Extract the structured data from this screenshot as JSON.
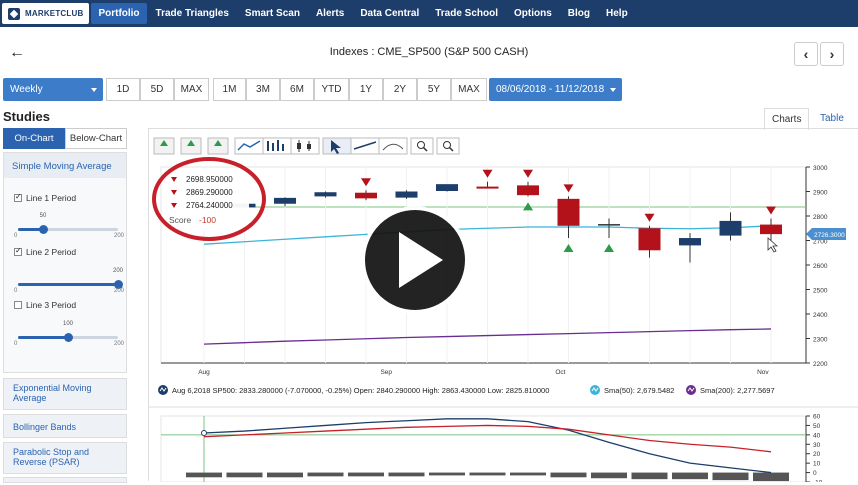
{
  "nav": {
    "logo": "MARKETCLUB",
    "items": [
      "Portfolio",
      "Trade Triangles",
      "Smart Scan",
      "Alerts",
      "Data Central",
      "Trade School",
      "Options",
      "Blog",
      "Help"
    ],
    "active": "Portfolio"
  },
  "header": {
    "title": "Indexes : CME_SP500 (S&P 500 CASH)",
    "back": "🡐",
    "prev": "‹",
    "next": "›"
  },
  "toolbar": {
    "period": "Weekly",
    "ranges1": [
      "1D",
      "5D",
      "MAX"
    ],
    "ranges2": [
      "1M",
      "3M",
      "6M",
      "YTD",
      "1Y",
      "2Y",
      "5Y",
      "MAX"
    ],
    "date_range": "08/06/2018 - 11/12/2018"
  },
  "studies": {
    "title": "Studies",
    "tab_on": "On-Chart",
    "tab_below": "Below-Chart",
    "sma_title": "Simple Moving Average",
    "lines": [
      {
        "label": "Line 1 Period",
        "checked": true,
        "value": "50",
        "min": "0",
        "max": "200",
        "fraction": 0.25
      },
      {
        "label": "Line 2 Period",
        "checked": true,
        "value": "200",
        "min": "0",
        "max": "200",
        "fraction": 1.0
      },
      {
        "label": "Line 3 Period",
        "checked": false,
        "value": "100",
        "min": "0",
        "max": "200",
        "fraction": 0.5
      }
    ],
    "others": [
      "Exponential Moving Average",
      "Bollinger Bands",
      "Parabolic Stop and Reverse (PSAR)"
    ]
  },
  "chart_tabs": [
    "Charts",
    "Table"
  ],
  "callout": {
    "values": [
      "2698.950000",
      "2869.290000",
      "2764.240000"
    ],
    "score_label": "Score",
    "score_value": "-100"
  },
  "legend": {
    "ohlc": "Aug 6,2018 SP500: 2833.280000 (-7.070000, -0.25%) Open: 2840.290000 High: 2863.430000 Low: 2825.810000",
    "sma50": "Sma(50): 2,679.5482",
    "sma200": "Sma(200): 2,277.5697"
  },
  "last_price_tag": "2726.3000",
  "colors": {
    "nav_bg": "#1d3d6b",
    "accent": "#2b63b0",
    "bull": "#1d3d6b",
    "bear": "#b3121a",
    "sma50": "#3bb4d9",
    "sma200": "#6a2c91",
    "triangle_up": "#2e9b4b"
  },
  "chart_data": {
    "type": "candlestick",
    "x_labels": [
      "Aug",
      "Sep",
      "Oct",
      "Nov"
    ],
    "y_ticks": [
      "3000",
      "2900",
      "2800",
      "2700",
      "2600",
      "2500",
      "2400",
      "2300",
      "2200"
    ],
    "ylim": [
      2200,
      3000
    ],
    "candles": [
      {
        "o": 2840,
        "h": 2863,
        "l": 2826,
        "c": 2833
      },
      {
        "o": 2835,
        "h": 2855,
        "l": 2830,
        "c": 2850
      },
      {
        "o": 2850,
        "h": 2876,
        "l": 2840,
        "c": 2874
      },
      {
        "o": 2880,
        "h": 2900,
        "l": 2875,
        "c": 2897
      },
      {
        "o": 2895,
        "h": 2905,
        "l": 2865,
        "c": 2872
      },
      {
        "o": 2875,
        "h": 2905,
        "l": 2870,
        "c": 2900
      },
      {
        "o": 2902,
        "h": 2920,
        "l": 2900,
        "c": 2930
      },
      {
        "o": 2920,
        "h": 2940,
        "l": 2915,
        "c": 2916
      },
      {
        "o": 2925,
        "h": 2940,
        "l": 2880,
        "c": 2885
      },
      {
        "o": 2870,
        "h": 2880,
        "l": 2710,
        "c": 2760
      },
      {
        "o": 2767,
        "h": 2790,
        "l": 2710,
        "c": 2767
      },
      {
        "o": 2750,
        "h": 2760,
        "l": 2630,
        "c": 2660
      },
      {
        "o": 2680,
        "h": 2730,
        "l": 2610,
        "c": 2710
      },
      {
        "o": 2720,
        "h": 2815,
        "l": 2700,
        "c": 2780
      },
      {
        "o": 2765,
        "h": 2790,
        "l": 2700,
        "c": 2726
      }
    ],
    "sma50": [
      2685,
      2695,
      2705,
      2715,
      2725,
      2735,
      2745,
      2750,
      2755,
      2755,
      2755,
      2750,
      2748,
      2752,
      2760
    ],
    "sma200": [
      2277,
      2283,
      2289,
      2294,
      2299,
      2304,
      2308,
      2312,
      2316,
      2320,
      2324,
      2328,
      2332,
      2336,
      2339
    ],
    "oscillator": {
      "y_ticks": [
        "60",
        "50",
        "40",
        "30",
        "20",
        "10",
        "0",
        "-10"
      ],
      "ylim": [
        -10,
        60
      ],
      "line_dark": [
        42,
        44,
        47,
        50,
        53,
        55,
        57,
        57,
        54,
        45,
        32,
        20,
        10,
        5,
        0
      ],
      "line_red": [
        38,
        40,
        42,
        44,
        46,
        48,
        49,
        50,
        49,
        46,
        40,
        34,
        30,
        27,
        22
      ],
      "bars": [
        -5,
        -5,
        -5,
        -4,
        -4,
        -4,
        -3,
        -3,
        -3,
        -5,
        -6,
        -7,
        -7,
        -8,
        -9
      ]
    }
  }
}
